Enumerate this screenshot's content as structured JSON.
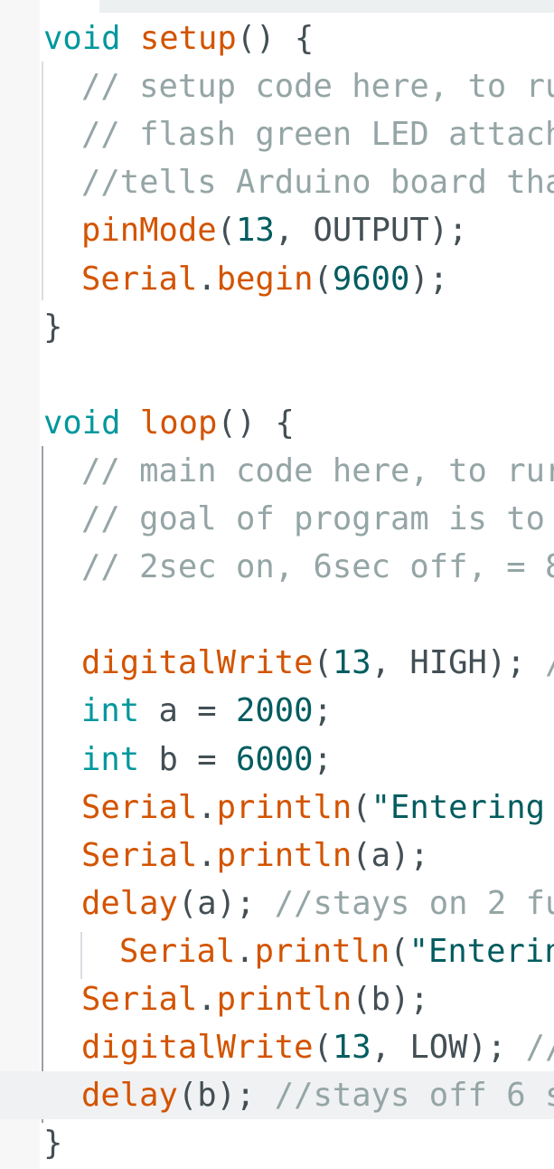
{
  "editor": {
    "colors": {
      "keyword": "#00979d",
      "function": "#d35400",
      "comment": "#95a5a6",
      "number": "#005c5f",
      "string": "#005c5f",
      "plain": "#434f54",
      "current_line": "#f0f1f2"
    },
    "lines": [
      {
        "tokens": [
          {
            "t": "void",
            "c": "kw"
          },
          {
            "t": " ",
            "c": "pl"
          },
          {
            "t": "setup",
            "c": "fn"
          },
          {
            "t": "() {",
            "c": "pl"
          }
        ]
      },
      {
        "tokens": [
          {
            "t": "// setup code here, to ru",
            "c": "cm"
          }
        ]
      },
      {
        "tokens": [
          {
            "t": "// flash green LED attach",
            "c": "cm"
          }
        ]
      },
      {
        "tokens": [
          {
            "t": "//tells Arduino board tha",
            "c": "cm"
          }
        ]
      },
      {
        "tokens": [
          {
            "t": "pinMode",
            "c": "fn"
          },
          {
            "t": "(",
            "c": "pl"
          },
          {
            "t": "13",
            "c": "nm"
          },
          {
            "t": ", OUTPUT);",
            "c": "pl"
          }
        ]
      },
      {
        "tokens": [
          {
            "t": "Serial",
            "c": "fn"
          },
          {
            "t": ".",
            "c": "pl"
          },
          {
            "t": "begin",
            "c": "fn"
          },
          {
            "t": "(",
            "c": "pl"
          },
          {
            "t": "9600",
            "c": "nm"
          },
          {
            "t": ");",
            "c": "pl"
          }
        ]
      },
      {
        "tokens": [
          {
            "t": "}",
            "c": "pl"
          }
        ]
      },
      {
        "tokens": []
      },
      {
        "tokens": [
          {
            "t": "void",
            "c": "kw"
          },
          {
            "t": " ",
            "c": "pl"
          },
          {
            "t": "loop",
            "c": "fn"
          },
          {
            "t": "() {",
            "c": "pl"
          }
        ]
      },
      {
        "tokens": [
          {
            "t": "// main code here, to rur",
            "c": "cm"
          }
        ]
      },
      {
        "tokens": [
          {
            "t": "// goal of program is to ",
            "c": "cm"
          }
        ]
      },
      {
        "tokens": [
          {
            "t": "// 2sec on, 6sec off, = 8",
            "c": "cm"
          }
        ]
      },
      {
        "tokens": []
      },
      {
        "tokens": [
          {
            "t": "digitalWrite",
            "c": "fn"
          },
          {
            "t": "(",
            "c": "pl"
          },
          {
            "t": "13",
            "c": "nm"
          },
          {
            "t": ", HIGH); ",
            "c": "pl"
          },
          {
            "t": "/",
            "c": "cm"
          }
        ]
      },
      {
        "tokens": [
          {
            "t": "int",
            "c": "kw"
          },
          {
            "t": " a = ",
            "c": "pl"
          },
          {
            "t": "2000",
            "c": "nm"
          },
          {
            "t": ";",
            "c": "pl"
          }
        ]
      },
      {
        "tokens": [
          {
            "t": "int",
            "c": "kw"
          },
          {
            "t": " b = ",
            "c": "pl"
          },
          {
            "t": "6000",
            "c": "nm"
          },
          {
            "t": ";",
            "c": "pl"
          }
        ]
      },
      {
        "tokens": [
          {
            "t": "Serial",
            "c": "fn"
          },
          {
            "t": ".",
            "c": "pl"
          },
          {
            "t": "println",
            "c": "fn"
          },
          {
            "t": "(",
            "c": "pl"
          },
          {
            "t": "\"Entering ",
            "c": "st"
          }
        ]
      },
      {
        "tokens": [
          {
            "t": "Serial",
            "c": "fn"
          },
          {
            "t": ".",
            "c": "pl"
          },
          {
            "t": "println",
            "c": "fn"
          },
          {
            "t": "(a);",
            "c": "pl"
          }
        ]
      },
      {
        "tokens": [
          {
            "t": "delay",
            "c": "fn"
          },
          {
            "t": "(a); ",
            "c": "pl"
          },
          {
            "t": "//stays on 2 fu",
            "c": "cm"
          }
        ]
      },
      {
        "tokens": [
          {
            "t": "Serial",
            "c": "fn"
          },
          {
            "t": ".",
            "c": "pl"
          },
          {
            "t": "println",
            "c": "fn"
          },
          {
            "t": "(",
            "c": "pl"
          },
          {
            "t": "\"Enterin",
            "c": "st"
          }
        ]
      },
      {
        "tokens": [
          {
            "t": "Serial",
            "c": "fn"
          },
          {
            "t": ".",
            "c": "pl"
          },
          {
            "t": "println",
            "c": "fn"
          },
          {
            "t": "(b);",
            "c": "pl"
          }
        ]
      },
      {
        "tokens": [
          {
            "t": "digitalWrite",
            "c": "fn"
          },
          {
            "t": "(",
            "c": "pl"
          },
          {
            "t": "13",
            "c": "nm"
          },
          {
            "t": ", LOW); ",
            "c": "pl"
          },
          {
            "t": "//",
            "c": "cm"
          }
        ]
      },
      {
        "tokens": [
          {
            "t": "delay",
            "c": "fn"
          },
          {
            "t": "(b); ",
            "c": "pl"
          },
          {
            "t": "//stays off 6 s",
            "c": "cm"
          }
        ]
      },
      {
        "tokens": [
          {
            "t": "}",
            "c": "pl"
          }
        ]
      }
    ]
  }
}
